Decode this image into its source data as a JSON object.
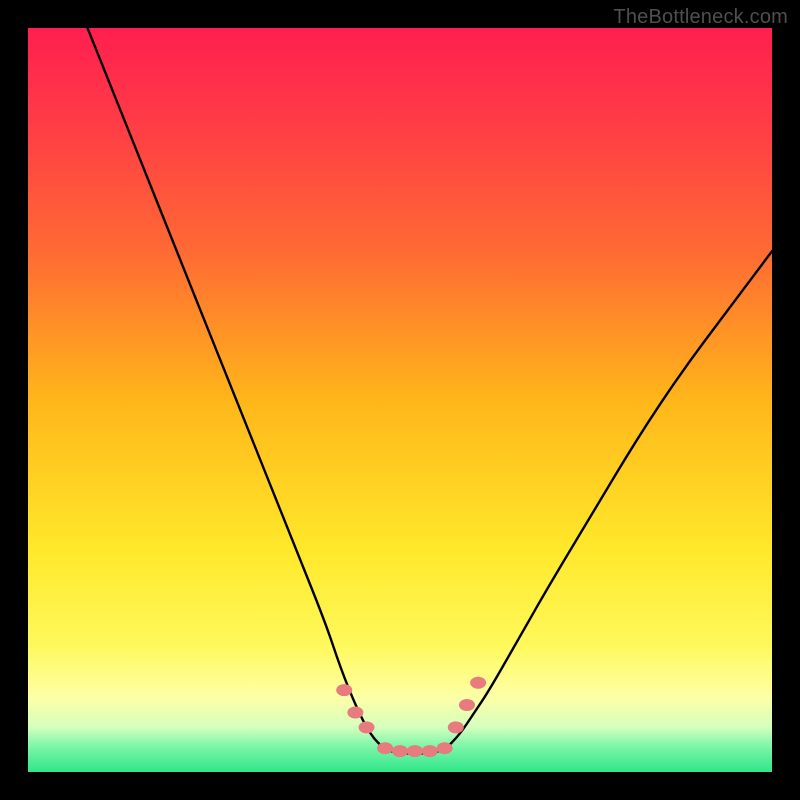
{
  "watermark": "TheBottleneck.com",
  "colors": {
    "frame": "#000000",
    "curve": "#000000",
    "marker_fill": "#e77b7d",
    "bottom_band": "#2fe68a",
    "gradient_stops": [
      {
        "offset": 0.0,
        "color": "#ff1f4f"
      },
      {
        "offset": 0.12,
        "color": "#ff3a47"
      },
      {
        "offset": 0.3,
        "color": "#ff6a34"
      },
      {
        "offset": 0.5,
        "color": "#ffb61a"
      },
      {
        "offset": 0.7,
        "color": "#ffe82a"
      },
      {
        "offset": 0.83,
        "color": "#fff95c"
      },
      {
        "offset": 0.9,
        "color": "#fdffa6"
      },
      {
        "offset": 0.94,
        "color": "#d4ffbe"
      },
      {
        "offset": 0.965,
        "color": "#7ef6a8"
      },
      {
        "offset": 1.0,
        "color": "#2fe68a"
      }
    ]
  },
  "chart_data": {
    "type": "line",
    "title": "",
    "xlabel": "",
    "ylabel": "",
    "xlim": [
      0,
      100
    ],
    "ylim": [
      0,
      100
    ],
    "grid": false,
    "legend": false,
    "series": [
      {
        "name": "left-curve",
        "x": [
          8,
          12,
          16,
          20,
          24,
          28,
          32,
          36,
          40,
          42,
          44,
          46,
          48
        ],
        "y": [
          100,
          90,
          80,
          70,
          60,
          50,
          40,
          30,
          20,
          14,
          9,
          5,
          3
        ]
      },
      {
        "name": "right-curve",
        "x": [
          56,
          58,
          60,
          62,
          66,
          70,
          76,
          82,
          88,
          94,
          100
        ],
        "y": [
          3,
          5,
          8,
          11,
          18,
          25,
          35,
          45,
          54,
          62,
          70
        ]
      },
      {
        "name": "valley-floor",
        "x": [
          48,
          50,
          52,
          54,
          56
        ],
        "y": [
          3,
          2.5,
          2.5,
          2.5,
          3
        ]
      }
    ],
    "markers": {
      "name": "valley-dots",
      "x": [
        42.5,
        44,
        45.5,
        48,
        50,
        52,
        54,
        56,
        57.5,
        59,
        60.5
      ],
      "y": [
        11,
        8,
        6,
        3.2,
        2.8,
        2.8,
        2.8,
        3.2,
        6,
        9,
        12
      ]
    }
  }
}
